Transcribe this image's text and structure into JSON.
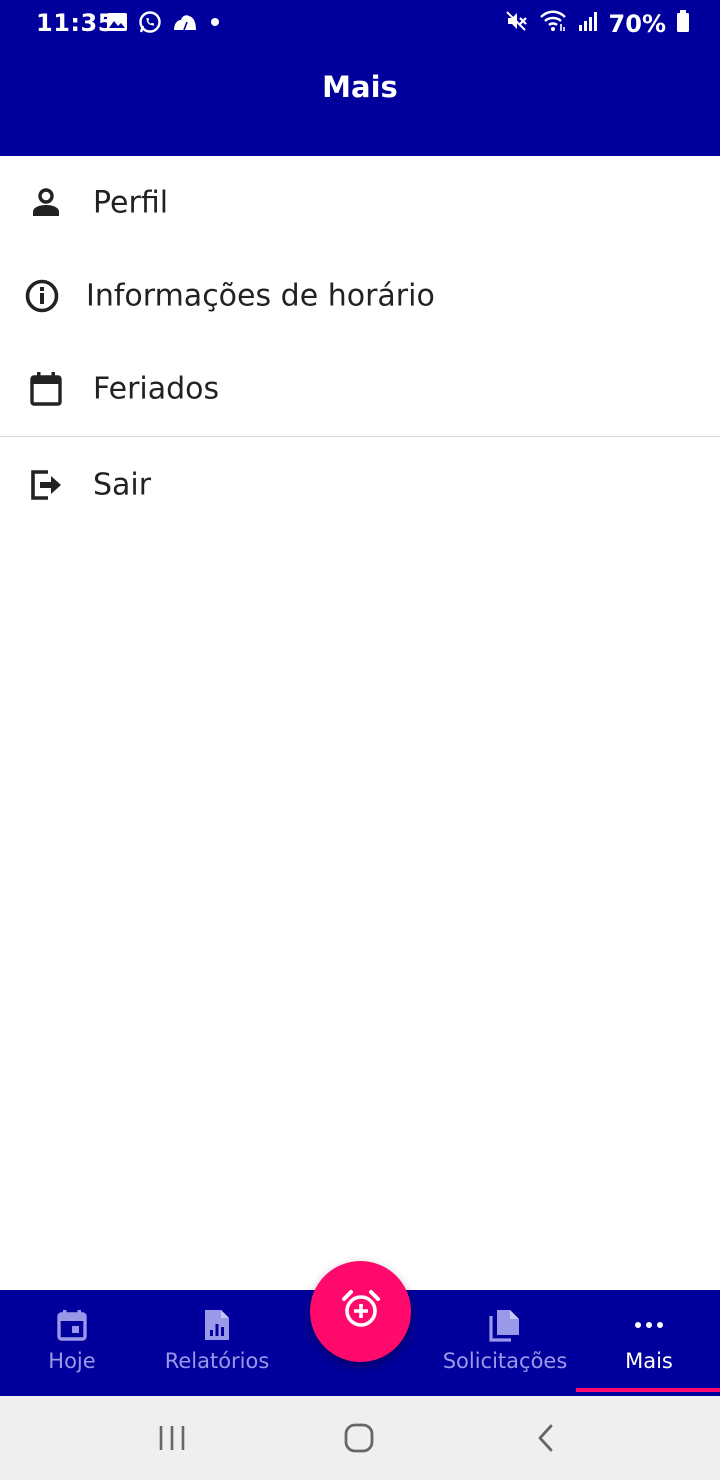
{
  "status_bar": {
    "time": "11:35",
    "battery_percent": "70%",
    "left_icons": [
      "image-icon",
      "whatsapp-icon",
      "cloud-icon",
      "dot-icon"
    ],
    "right_icons": [
      "mute-icon",
      "wifi-icon",
      "signal-icon",
      "battery-icon"
    ]
  },
  "app_bar": {
    "title": "Mais"
  },
  "menu": {
    "items": [
      {
        "label": "Perfil",
        "icon": "person-icon"
      },
      {
        "label": "Informações de horário",
        "icon": "info-icon"
      },
      {
        "label": "Feriados",
        "icon": "calendar-icon"
      },
      {
        "label": "Sair",
        "icon": "logout-icon"
      }
    ]
  },
  "bottom_nav": {
    "items": [
      {
        "label": "Hoje",
        "icon": "calendar-today-icon",
        "active": false
      },
      {
        "label": "Relatórios",
        "icon": "report-icon",
        "active": false
      },
      {
        "label": "Solicitações",
        "icon": "documents-icon",
        "active": false
      },
      {
        "label": "Mais",
        "icon": "more-icon",
        "active": true
      }
    ],
    "fab_icon": "alarm-add-icon"
  },
  "system_nav": {
    "buttons": [
      "recents-icon",
      "home-icon",
      "back-icon"
    ]
  },
  "colors": {
    "primary": "#02009c",
    "accent": "#ff0a6c",
    "inactive_nav": "#9a98e8",
    "system_bar": "#efefef"
  }
}
